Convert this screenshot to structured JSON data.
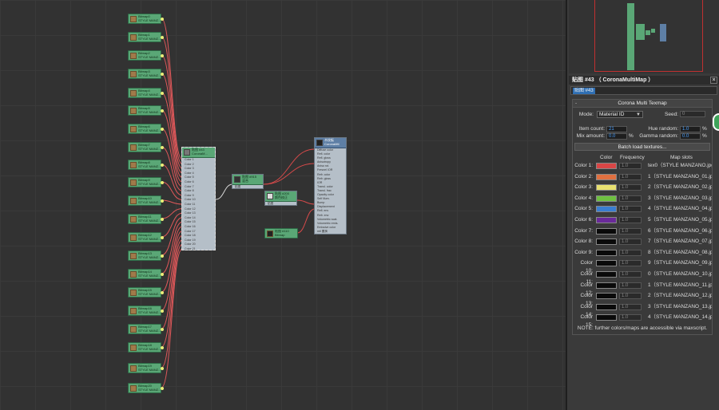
{
  "bitmap_nodes": [
    {
      "l1": "Bitmap0",
      "l2": "STYLE MANZ..."
    },
    {
      "l1": "Bitmap1",
      "l2": "STYLE MANZ..."
    },
    {
      "l1": "Bitmap2",
      "l2": "STYLE MANZ..."
    },
    {
      "l1": "Bitmap3",
      "l2": "STYLE MANZ..."
    },
    {
      "l1": "Bitmap4",
      "l2": "STYLE MANZ..."
    },
    {
      "l1": "Bitmap5",
      "l2": "STYLE MANZ..."
    },
    {
      "l1": "Bitmap6",
      "l2": "STYLE MANZ..."
    },
    {
      "l1": "Bitmap7",
      "l2": "STYLE MANZ..."
    },
    {
      "l1": "Bitmap8",
      "l2": "STYLE MANZ..."
    },
    {
      "l1": "Bitmap9",
      "l2": "STYLE MANZ..."
    },
    {
      "l1": "Bitmap10",
      "l2": "STYLE MANZ..."
    },
    {
      "l1": "Bitmap11",
      "l2": "STYLE MANZ..."
    },
    {
      "l1": "Bitmap12",
      "l2": "STYLE MANZ..."
    },
    {
      "l1": "Bitmap13",
      "l2": "STYLE MANZ..."
    },
    {
      "l1": "Bitmap14",
      "l2": "STYLE MANZ..."
    },
    {
      "l1": "Bitmap15",
      "l2": "STYLE MANZ..."
    },
    {
      "l1": "Bitmap16",
      "l2": "STYLE MANZ..."
    },
    {
      "l1": "Bitmap17",
      "l2": "STYLE MANZ..."
    },
    {
      "l1": "Bitmap18",
      "l2": "STYLE MANZ..."
    },
    {
      "l1": "Bitmap19",
      "l2": "STYLE MANZ..."
    },
    {
      "l1": "Bitmap20",
      "l2": "STYLE MANZ..."
    }
  ],
  "multimap_node": {
    "l1": "贴图 #43",
    "l2": "CoronaM...",
    "slots": [
      "Color 1",
      "Color 2",
      "Color 3",
      "Color 4",
      "Color 5",
      "Color 6",
      "Color 7",
      "Color 8",
      "Color 9",
      "Color 10",
      "Color 11",
      "Color 12",
      "Color 13",
      "Color 14",
      "Color 15",
      "Color 16",
      "Color 17",
      "Color 18",
      "Color 19",
      "Color 20",
      "Color 21"
    ]
  },
  "mid_nodes": [
    {
      "l1": "贴图 #915",
      "l2": "混合",
      "port": "贴图"
    },
    {
      "l1": "贴图 #200",
      "l2": "颜色校正",
      "port": "贴图"
    },
    {
      "l1": "贴图 #110",
      "l2": "Bitmap",
      "port": ""
    }
  ],
  "material_node": {
    "l1": "木纹板",
    "l2": "CoronaMtl",
    "slots": [
      "Diffuse color",
      "Refl. color",
      "Refl. gloss",
      "Anisotropy",
      "Aniso rot.",
      "Fresnel IOR",
      "Refr. color",
      "Refr. gloss",
      "IOR",
      "Transl. color",
      "Transl. frac",
      "Opacity color",
      "Self illum.",
      "Bump",
      "Displacement",
      "Refl. env",
      "Refr. env",
      "Volumetric scat.",
      "Volumetric emis.",
      "Emissive color",
      "mtl 置换"
    ]
  },
  "panel": {
    "title": "贴图 #43 （ CoronaMultiMap ）",
    "name": "贴图 #43",
    "rollout_title": "Corona Multi Texmap",
    "rollout_toggle": "-",
    "mode_label": "Mode:",
    "mode_value": "Material ID",
    "seed_label": "Seed:",
    "seed_value": "0",
    "item_count_label": "Item count:",
    "item_count_value": "21",
    "hue_random_label": "Hue random:",
    "hue_random_value": "1.0",
    "mix_amount_label": "Mix amount:",
    "mix_amount_value": "0.0",
    "gamma_random_label": "Gamma random:",
    "gamma_random_value": "0.0",
    "pct": "%",
    "batch_button": "Batch load textures...",
    "col_color": "Color",
    "col_frequency": "Frequency",
    "col_mapslots": "Map slots",
    "rows": [
      {
        "label": "Color 1:",
        "color": "#d94646",
        "freq": "1.0",
        "map": "tex0（STYLE MANZANO.jpg）"
      },
      {
        "label": "Color 2:",
        "color": "#e07040",
        "freq": "1.0",
        "map": "1（STYLE MANZANO_01.jpg）"
      },
      {
        "label": "Color 3:",
        "color": "#e8e070",
        "freq": "1.0",
        "map": "2（STYLE MANZANO_02.jpg）"
      },
      {
        "label": "Color 4:",
        "color": "#6ec040",
        "freq": "1.0",
        "map": "3（STYLE MANZANO_03.jpg）"
      },
      {
        "label": "Color 5:",
        "color": "#3a7ed0",
        "freq": "1.0",
        "map": "4（STYLE MANZANO_04.jpg）"
      },
      {
        "label": "Color 6:",
        "color": "#6a2a9a",
        "freq": "1.0",
        "map": "5（STYLE MANZANO_05.jpg）"
      },
      {
        "label": "Color 7:",
        "color": "#0a0a0a",
        "freq": "1.0",
        "map": "6（STYLE MANZANO_06.jpg）"
      },
      {
        "label": "Color 8:",
        "color": "#0a0a0a",
        "freq": "1.0",
        "map": "7（STYLE MANZANO_07.jpg）"
      },
      {
        "label": "Color 9:",
        "color": "#0a0a0a",
        "freq": "1.0",
        "map": "8（STYLE MANZANO_08.jpg）"
      },
      {
        "label": "Color 10:",
        "color": "#0a0a0a",
        "freq": "1.0",
        "map": "9（STYLE MANZANO_09.jpg）"
      },
      {
        "label": "Color 11:",
        "color": "#0a0a0a",
        "freq": "1.0",
        "map": "0（STYLE MANZANO_10.jpg）"
      },
      {
        "label": "Color 12:",
        "color": "#0a0a0a",
        "freq": "1.0",
        "map": "1（STYLE MANZANO_11.jpg）"
      },
      {
        "label": "Color 13:",
        "color": "#0a0a0a",
        "freq": "1.0",
        "map": "2（STYLE MANZANO_12.jpg）"
      },
      {
        "label": "Color 14:",
        "color": "#0a0a0a",
        "freq": "1.0",
        "map": "3（STYLE MANZANO_13.jpg）"
      },
      {
        "label": "Color 15:",
        "color": "#0a0a0a",
        "freq": "1.0",
        "map": "4（STYLE MANZANO_14.jpg）"
      }
    ],
    "note": "NOTE: further colors/maps are accessible via maxscript."
  }
}
